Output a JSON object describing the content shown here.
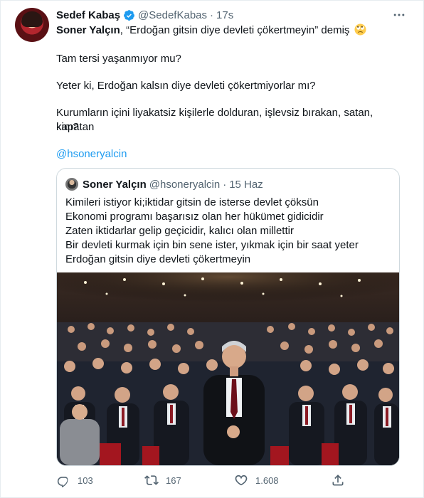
{
  "tweet": {
    "author_name": "Sedef Kabaş",
    "author_handle": "@SedefKabas",
    "separator": "·",
    "time": "17s",
    "lead_name": "Soner Yalçın",
    "lead_rest": ", “Erdoğan gitsin diye devleti çökertmeyin” demiş",
    "para1": "Tam tersi yaşanmıyor mu?",
    "para2": "Yeter ki, Erdoğan kalsın diye devleti çökertmiyorlar mı?",
    "para3_line1": "Kurumların içini liyakatsiz kişilerle dolduran, işlevsiz bırakan, satan, kapatan",
    "para3_line2": "kim?",
    "mention": "@hsoneryalcin"
  },
  "quote": {
    "name": "Soner Yalçın",
    "handle": "@hsoneryalcin",
    "separator": "·",
    "time": "15 Haz",
    "lines": [
      "Kimileri istiyor ki;iktidar gitsin de isterse devlet çöksün",
      "Ekonomi programı başarısız olan her hükümet gidicidir",
      "Zaten iktidarlar gelip geçicidir, kalıcı olan millettir",
      "Bir devleti kurmak için bin sene ister, yıkmak için bir saat yeter",
      "Erdoğan gitsin diye devleti çökertmeyin"
    ]
  },
  "actions": {
    "reply_count": "103",
    "retweet_count": "167",
    "like_count": "1.608"
  },
  "icons": {
    "verified": "verified-badge-icon",
    "more": "more-horizontal-icon",
    "emoji": "face-with-rolling-eyes-emoji",
    "reply": "reply-icon",
    "retweet": "retweet-icon",
    "like": "like-heart-icon",
    "share": "share-icon"
  },
  "colors": {
    "accent": "#1d9bf0",
    "text": "#0f1419",
    "muted": "#536471",
    "border": "#cfd9de"
  }
}
